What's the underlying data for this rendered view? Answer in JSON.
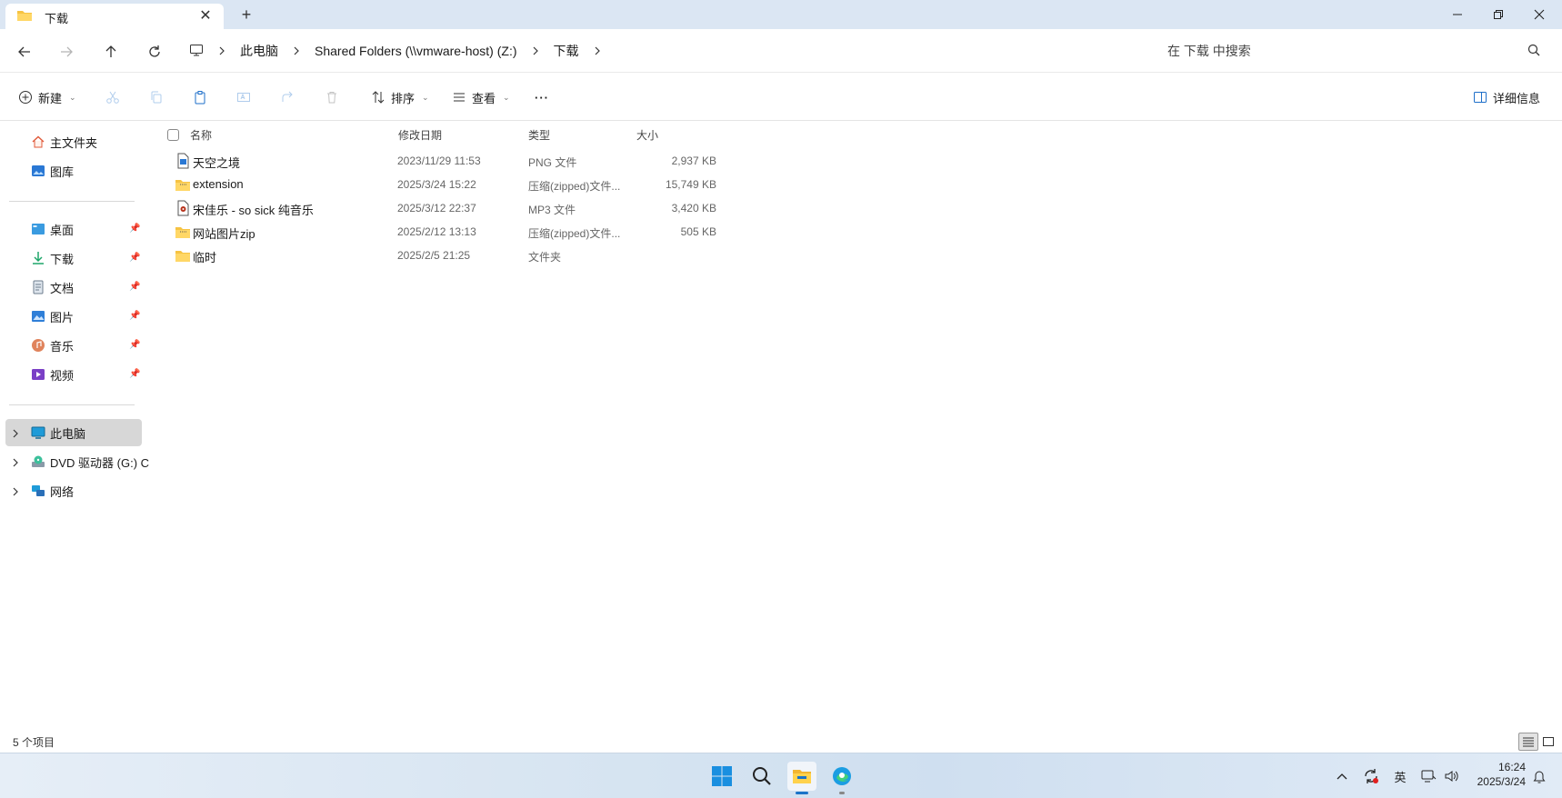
{
  "titlebar": {
    "tab_label": "下载",
    "tab_icon": "folder-icon",
    "new_tab_label": "+",
    "colors": {
      "bar": "#dbe6f3",
      "tab": "#ffffff"
    }
  },
  "address": {
    "crumbs": [
      "此电脑",
      "Shared Folders (\\\\vmware-host) (Z:)",
      "下载"
    ],
    "search_placeholder": "在 下载 中搜索"
  },
  "commands": {
    "new_label": "新建",
    "sort_label": "排序",
    "view_label": "查看",
    "more_label": "···",
    "details_label": "详细信息"
  },
  "sidebar": {
    "top": [
      {
        "label": "主文件夹",
        "icon": "home-icon"
      },
      {
        "label": "图库",
        "icon": "gallery-icon"
      }
    ],
    "pinned": [
      {
        "label": "桌面",
        "icon": "desktop-icon"
      },
      {
        "label": "下载",
        "icon": "download-icon"
      },
      {
        "label": "文档",
        "icon": "document-icon"
      },
      {
        "label": "图片",
        "icon": "pictures-icon"
      },
      {
        "label": "音乐",
        "icon": "music-icon"
      },
      {
        "label": "视频",
        "icon": "video-icon"
      }
    ],
    "drives": [
      {
        "label": "此电脑",
        "icon": "this-pc-icon",
        "selected": true
      },
      {
        "label": "DVD 驱动器 (G:) C",
        "icon": "dvd-drive-icon"
      },
      {
        "label": "网络",
        "icon": "network-icon"
      }
    ]
  },
  "files": {
    "headers": {
      "name": "名称",
      "date": "修改日期",
      "type": "类型",
      "size": "大小"
    },
    "rows": [
      {
        "name": "天空之境",
        "date": "2023/11/29 11:53",
        "type": "PNG 文件",
        "size": "2,937 KB",
        "icon": "png-file-icon"
      },
      {
        "name": "extension",
        "date": "2025/3/24 15:22",
        "type": "压缩(zipped)文件...",
        "size": "15,749 KB",
        "icon": "zip-folder-icon"
      },
      {
        "name": "宋佳乐 - so sick 纯音乐",
        "date": "2025/3/12 22:37",
        "type": "MP3 文件",
        "size": "3,420 KB",
        "icon": "mp3-file-icon"
      },
      {
        "name": "网站图片zip",
        "date": "2025/2/12 13:13",
        "type": "压缩(zipped)文件...",
        "size": "505 KB",
        "icon": "zip-folder-icon"
      },
      {
        "name": "临时",
        "date": "2025/2/5 21:25",
        "type": "文件夹",
        "size": "",
        "icon": "folder-icon"
      }
    ]
  },
  "status": {
    "count": "5 个项目"
  },
  "taskbar": {
    "apps": [
      "start-icon",
      "search-icon",
      "file-explorer-icon",
      "edge-icon"
    ],
    "ime": "英",
    "time": "16:24",
    "date": "2025/3/24"
  }
}
